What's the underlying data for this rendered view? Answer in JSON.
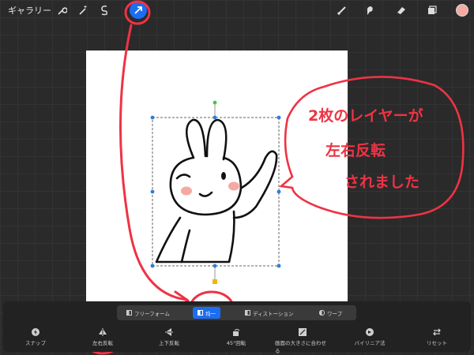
{
  "topbar": {
    "gallery_label": "ギャラリー",
    "left_icons": [
      "wrench-icon",
      "magic-wand-icon",
      "selection-icon",
      "transform-arrow-icon"
    ],
    "right_icons": [
      "brush-icon",
      "smudge-icon",
      "eraser-icon",
      "layers-icon",
      "color-swatch"
    ],
    "color_swatch": "#f4a9a3"
  },
  "transform_modes": [
    {
      "label": "フリーフォーム",
      "active": false
    },
    {
      "label": "均一",
      "active": true
    },
    {
      "label": "ディストーション",
      "active": false
    },
    {
      "label": "ワープ",
      "active": false
    }
  ],
  "tools": [
    {
      "label": "スナップ",
      "icon": "snap-icon"
    },
    {
      "label": "左右反転",
      "icon": "flip-horizontal-icon"
    },
    {
      "label": "上下反転",
      "icon": "flip-vertical-icon"
    },
    {
      "label": "45°回転",
      "icon": "rotate-icon"
    },
    {
      "label": "画面の大きさに合わせる",
      "icon": "fit-to-screen-icon"
    },
    {
      "label": "バイリニア法",
      "icon": "interpolation-icon"
    },
    {
      "label": "リセット",
      "icon": "reset-icon"
    }
  ],
  "annotation": {
    "lines": [
      "2枚のレイヤーが",
      "左右反転",
      "されました"
    ],
    "color": "#ee3344"
  },
  "colors": {
    "accent": "#1d6df2",
    "handle_blue": "#2a7de1",
    "handle_green": "#3ec84a",
    "handle_orange": "#f5b400",
    "blush": "#f4a9a3"
  }
}
